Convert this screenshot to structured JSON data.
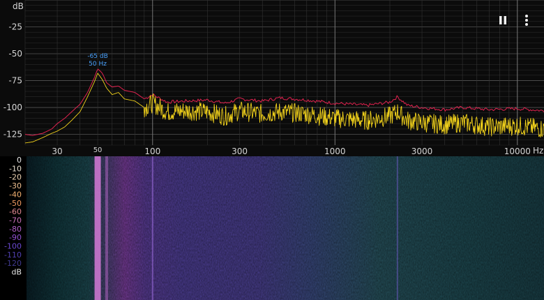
{
  "chart_data": {
    "type": "line",
    "x_scale": "log",
    "xlim": [
      20,
      14000
    ],
    "ylim": [
      -135,
      0
    ],
    "yunit": "dB",
    "xunit": "Hz",
    "y_ticks": [
      "-25",
      "-50",
      "-75",
      "-100",
      "-125"
    ],
    "x_ticks": [
      "30",
      "50",
      "100",
      "300",
      "1000",
      "3000",
      "10000"
    ],
    "peak_marker": {
      "level": "-65 dB",
      "freq": "50 Hz",
      "x": 50,
      "y": -65
    },
    "series": [
      {
        "color": "#e0224f",
        "x": [
          20,
          22,
          25,
          28,
          30,
          33,
          36,
          40,
          44,
          48,
          50,
          53,
          56,
          60,
          65,
          70,
          80,
          90,
          100,
          120,
          150,
          200,
          250,
          300,
          400,
          500,
          700,
          1000,
          1500,
          2000,
          2200,
          2500,
          3000,
          4000,
          5000,
          7000,
          10000,
          14000
        ],
        "y": [
          -125,
          -126,
          -124,
          -120,
          -115,
          -110,
          -104,
          -97,
          -86,
          -72,
          -64,
          -68,
          -77,
          -81,
          -80,
          -84,
          -86,
          -92,
          -88,
          -95,
          -94,
          -93,
          -96,
          -92,
          -94,
          -91,
          -93,
          -96,
          -98,
          -95,
          -90,
          -98,
          -100,
          -102,
          -100,
          -102,
          -101,
          -103
        ]
      },
      {
        "color": "#f2d21b",
        "x": [
          20,
          22,
          25,
          28,
          30,
          33,
          36,
          40,
          44,
          48,
          50,
          53,
          56,
          60,
          65,
          70,
          80,
          90,
          100,
          120,
          150,
          200,
          250,
          300,
          400,
          500,
          700,
          1000,
          1500,
          2000,
          2200,
          2500,
          3000,
          4000,
          5000,
          7000,
          10000,
          14000
        ],
        "y": [
          -133,
          -132,
          -128,
          -124,
          -122,
          -118,
          -112,
          -104,
          -90,
          -76,
          -68,
          -74,
          -82,
          -88,
          -86,
          -92,
          -94,
          -100,
          -96,
          -104,
          -103,
          -104,
          -108,
          -103,
          -106,
          -104,
          -106,
          -110,
          -112,
          -108,
          -104,
          -112,
          -114,
          -116,
          -114,
          -118,
          -117,
          -120
        ]
      }
    ]
  },
  "spectrogram": {
    "db_labels": [
      "0",
      "-10",
      "-20",
      "-30",
      "-40",
      "-50",
      "-60",
      "-70",
      "-80",
      "-90",
      "-100",
      "-110",
      "-120",
      "dB"
    ],
    "db_colors": [
      "#e6e6e6",
      "#e8e0d0",
      "#ead0b0",
      "#f0c090",
      "#f2b070",
      "#f09a60",
      "#e08890",
      "#c870b8",
      "#b060c8",
      "#9050d0",
      "#6a48d0",
      "#5040b0",
      "#403a90",
      "#e6e6e6"
    ]
  },
  "controls": {
    "pause_icon": "pause-icon",
    "menu_icon": "more-vert-icon"
  }
}
